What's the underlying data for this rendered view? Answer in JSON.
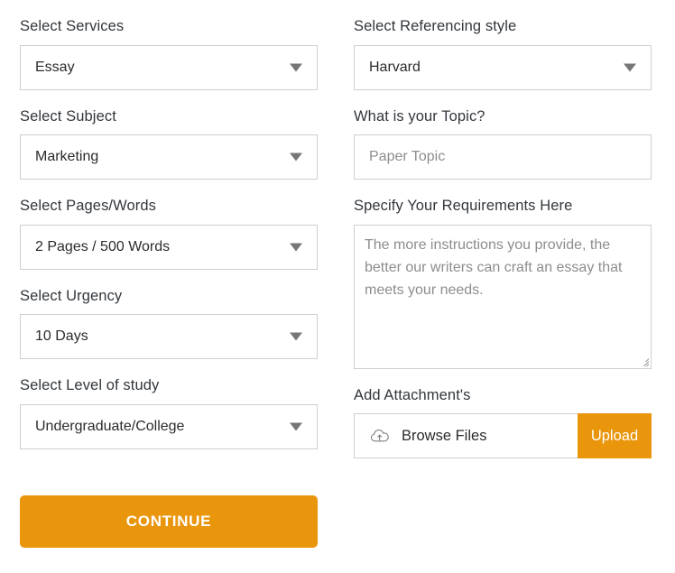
{
  "form": {
    "left_column": {
      "services": {
        "label": "Select Services",
        "value": "Essay",
        "caret_icon": "chevron-down-icon"
      },
      "subject": {
        "label": "Select Subject",
        "value": "Marketing",
        "caret_icon": "chevron-down-icon"
      },
      "pages_words": {
        "label": "Select Pages/Words",
        "value": "2 Pages / 500 Words",
        "caret_icon": "chevron-down-icon"
      },
      "urgency": {
        "label": "Select Urgency",
        "value": "10 Days",
        "caret_icon": "chevron-down-icon"
      },
      "level_of_study": {
        "label": "Select Level of study",
        "value": "Undergraduate/College",
        "caret_icon": "chevron-down-icon"
      },
      "continue_button": {
        "label": "CONTINUE"
      }
    },
    "right_column": {
      "referencing_style": {
        "label": "Select Referencing style",
        "value": "Harvard",
        "caret_icon": "chevron-down-icon"
      },
      "topic": {
        "label": "What is your Topic?",
        "value": "",
        "placeholder": "Paper Topic"
      },
      "requirements": {
        "label": "Specify Your Requirements Here",
        "value": "",
        "placeholder": "The more instructions you provide, the better our writers can craft an essay that meets your needs."
      },
      "attachments": {
        "label": "Add Attachment's",
        "browse_label": "Browse Files",
        "browse_icon": "cloud-upload-icon",
        "upload_label": "Upload"
      }
    }
  },
  "colors": {
    "accent_orange": "#e9960c",
    "border_gray": "#cfcfcf",
    "label_text": "#32373c",
    "placeholder_text": "#8d8d8d"
  }
}
